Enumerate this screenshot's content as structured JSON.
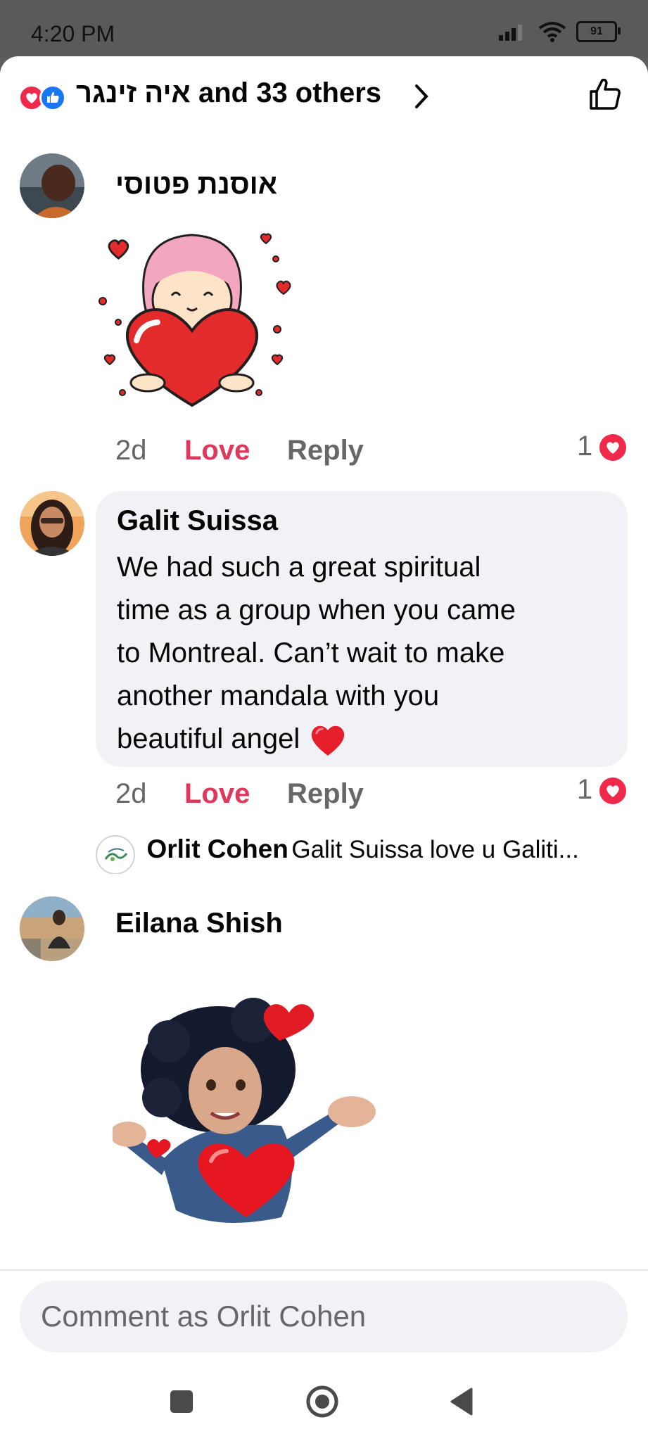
{
  "status_bar": {
    "time": "4:20 PM",
    "battery": "91"
  },
  "header": {
    "reaction_names": "איה זינגר",
    "reaction_summary_rest": "and 33 others"
  },
  "comments": [
    {
      "author": "אוסנת פטוסי",
      "time": "2d",
      "love_label": "Love",
      "reply_label": "Reply",
      "reaction_count": "1",
      "sticker": "heart-hug-sticker"
    },
    {
      "author": "Galit Suissa",
      "text_lines": [
        "We had such a great spiritual",
        "time as a group when you came",
        "to Montreal. Can’t wait to make",
        "another mandala with you",
        "beautiful angel"
      ],
      "time": "2d",
      "love_label": "Love",
      "reply_label": "Reply",
      "reaction_count": "1",
      "reply_preview": {
        "author": "Orlit Cohen",
        "text": "Galit Suissa love u Galiti..."
      }
    },
    {
      "author": "Eilana Shish",
      "sticker": "avatar-hearts-sticker"
    }
  ],
  "composer": {
    "placeholder": "Comment as Orlit Cohen"
  },
  "colors": {
    "love": "#e0385c",
    "like": "#1877f2",
    "bubble": "#f0f2f5"
  }
}
